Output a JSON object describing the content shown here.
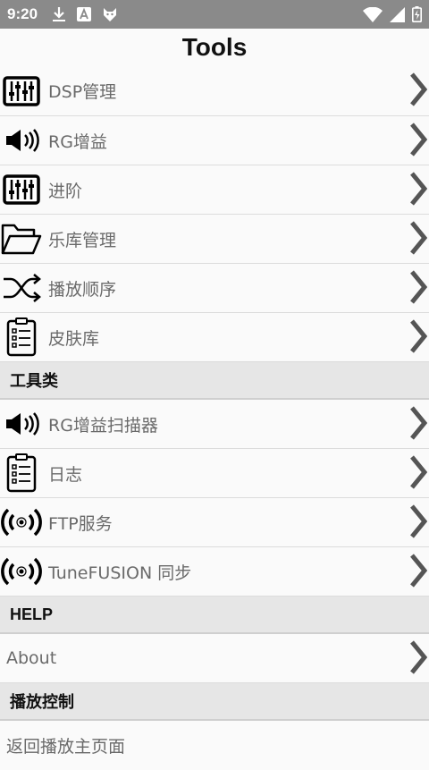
{
  "status": {
    "time": "9:20"
  },
  "title": "Tools",
  "rows_main": [
    {
      "label": "DSP管理",
      "icon": "equalizer-icon"
    },
    {
      "label": "RG增益",
      "icon": "speaker-icon"
    },
    {
      "label": "进阶",
      "icon": "equalizer-icon"
    },
    {
      "label": "乐库管理",
      "icon": "folder-icon"
    },
    {
      "label": "播放顺序",
      "icon": "shuffle-icon"
    },
    {
      "label": "皮肤库",
      "icon": "clipboard-list-icon"
    }
  ],
  "sections": {
    "tools": "工具类",
    "help": "HELP",
    "playback": "播放控制"
  },
  "rows_tools": [
    {
      "label": "RG增益扫描器",
      "icon": "speaker-icon"
    },
    {
      "label": "日志",
      "icon": "clipboard-list-icon"
    },
    {
      "label": "FTP服务",
      "icon": "broadcast-icon"
    },
    {
      "label": "TuneFUSION 同步",
      "icon": "broadcast-icon"
    }
  ],
  "rows_help": [
    {
      "label": "About"
    }
  ],
  "rows_playback": [
    {
      "label": "返回播放主页面"
    }
  ]
}
